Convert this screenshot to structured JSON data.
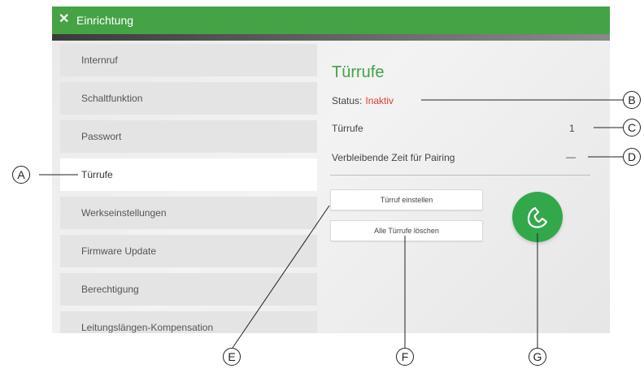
{
  "titlebar": {
    "title": "Einrichtung",
    "close_icon": "close-icon"
  },
  "sidebar": {
    "items": [
      {
        "label": "Internruf",
        "active": false
      },
      {
        "label": "Schaltfunktion",
        "active": false
      },
      {
        "label": "Passwort",
        "active": false
      },
      {
        "label": "Türrufe",
        "active": true
      },
      {
        "label": "Werkseinstellungen",
        "active": false
      },
      {
        "label": "Firmware Update",
        "active": false
      },
      {
        "label": "Berechtigung",
        "active": false
      },
      {
        "label": "Leitungslängen-Kompensation",
        "active": false
      }
    ]
  },
  "content": {
    "title": "Türrufe",
    "status_label": "Status:",
    "status_value": "Inaktiv",
    "count_label": "Türrufe",
    "count_value": "1",
    "pairing_label": "Verbleibende Zeit für Pairing",
    "pairing_value": "—",
    "btn_set": "Türruf einstellen",
    "btn_delete": "Alle Türrufe löschen",
    "call_icon": "phone-handset-icon"
  },
  "callouts": {
    "a": "A",
    "b": "B",
    "c": "C",
    "d": "D",
    "e": "E",
    "f": "F",
    "g": "G"
  },
  "colors": {
    "accent": "#45a346",
    "title_green": "#3fa34a",
    "status_red": "#e53935"
  }
}
